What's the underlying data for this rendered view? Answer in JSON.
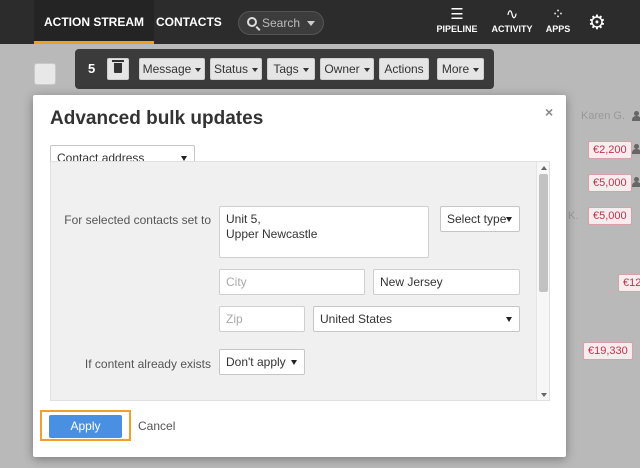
{
  "nav": {
    "tabs": [
      {
        "label": "ACTION STREAM",
        "active": true
      },
      {
        "label": "CONTACTS",
        "active": false
      }
    ],
    "search_placeholder": "Search",
    "icons": [
      {
        "label": "PIPELINE",
        "icon": "pipeline-icon"
      },
      {
        "label": "ACTIVITY",
        "icon": "activity-icon"
      },
      {
        "label": "APPS",
        "icon": "apps-icon"
      }
    ],
    "settings_icon": "gear-icon"
  },
  "toolbar": {
    "selected_count": "5",
    "buttons": [
      "Message",
      "Status",
      "Tags",
      "Owner",
      "Actions",
      "More"
    ]
  },
  "background": {
    "owner_name": "Karen G.",
    "partial_name": "K.",
    "amounts": [
      "€2,200",
      "€5,000",
      "€5,000",
      "€12",
      "€19,330"
    ]
  },
  "modal": {
    "title": "Advanced bulk updates",
    "close_label": "×",
    "field_select": "Contact address",
    "row_label": "For selected contacts set to",
    "address_value": "Unit 5,\nUpper Newcastle",
    "type_select": "Select type",
    "city_placeholder": "City",
    "state_value": "New Jersey",
    "zip_placeholder": "Zip",
    "country_value": "United States",
    "exists_label": "If content already exists",
    "exists_select": "Don't apply",
    "apply_label": "Apply",
    "cancel_label": "Cancel"
  },
  "colors": {
    "topbar": "#2c2c2c",
    "active_tab_accent": "#f0a020",
    "apply_button": "#4a90e2",
    "amount_text": "#c0334b",
    "highlight_border": "#f0a030"
  }
}
